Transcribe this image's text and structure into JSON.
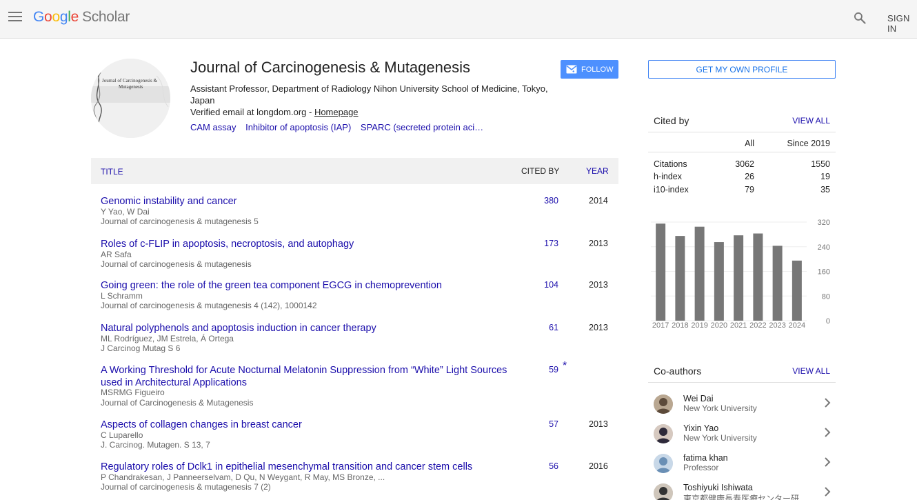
{
  "header": {
    "menu_icon": "hamburger-menu-icon",
    "logo_google": "Google",
    "logo_scholar": "Scholar",
    "search_icon": "search-icon",
    "sign_in": "SIGN IN",
    "logo_colors": [
      "#4285f4",
      "#ea4335",
      "#fbbc05",
      "#4285f4",
      "#34a853",
      "#ea4335"
    ]
  },
  "profile": {
    "name": "Journal of Carcinogenesis & Mutagenesis",
    "affiliation": "Assistant Professor, Department of Radiology Nihon University School of Medicine, Tokyo, Japan",
    "verified_email": "Verified email at longdom.org - ",
    "homepage": "Homepage",
    "interests": [
      "CAM assay",
      "Inhibitor of apoptosis (IAP)",
      "SPARC (secreted protein aci…"
    ],
    "follow_label": "FOLLOW",
    "avatar_text_1": "Journal of Carcinogenesis &",
    "avatar_text_2": "Mutagenesis"
  },
  "articles_table": {
    "col_title": "TITLE",
    "col_cited_by": "CITED BY",
    "col_year": "YEAR",
    "rows": [
      {
        "title": "Genomic instability and cancer",
        "authors": "Y Yao, W Dai",
        "venue": "Journal of carcinogenesis & mutagenesis 5",
        "cited_by": "380",
        "year": "2014",
        "star": ""
      },
      {
        "title": "Roles of c-FLIP in apoptosis, necroptosis, and autophagy",
        "authors": "AR Safa",
        "venue": "Journal of carcinogenesis & mutagenesis",
        "cited_by": "173",
        "year": "2013",
        "star": ""
      },
      {
        "title": "Going green: the role of the green tea component EGCG in chemoprevention",
        "authors": "L Schramm",
        "venue": "Journal of carcinogenesis & mutagenesis 4 (142), 1000142",
        "cited_by": "104",
        "year": "2013",
        "star": ""
      },
      {
        "title": "Natural polyphenols and apoptosis induction in cancer therapy",
        "authors": "ML Rodríguez, JM Estrela, Á Ortega",
        "venue": "J Carcinog Mutag S 6",
        "cited_by": "61",
        "year": "2013",
        "star": ""
      },
      {
        "title": "A Working Threshold for Acute Nocturnal Melatonin Suppression from “White” Light Sources used in Architectural Applications",
        "authors": "MSRMG Figueiro",
        "venue": "Journal of Carcinogenesis & Mutagenesis",
        "cited_by": "59",
        "year": "",
        "star": "*"
      },
      {
        "title": "Aspects of collagen changes in breast cancer",
        "authors": "C Luparello",
        "venue": "J. Carcinog. Mutagen. S 13, 7",
        "cited_by": "57",
        "year": "2013",
        "star": ""
      },
      {
        "title": "Regulatory roles of Dclk1 in epithelial mesenchymal transition and cancer stem cells",
        "authors": "P Chandrakesan, J Panneerselvam, D Qu, N Weygant, R May, MS Bronze, ...",
        "venue": "Journal of carcinogenesis & mutagenesis 7 (2)",
        "cited_by": "56",
        "year": "2016",
        "star": ""
      }
    ]
  },
  "sidebar": {
    "own_profile": "GET MY OWN PROFILE",
    "cited_by": {
      "title": "Cited by",
      "view_all": "VIEW ALL",
      "col_all": "All",
      "col_since": "Since 2019",
      "rows": [
        {
          "label": "Citations",
          "all": "3062",
          "since": "1550"
        },
        {
          "label": "h-index",
          "all": "26",
          "since": "19"
        },
        {
          "label": "i10-index",
          "all": "79",
          "since": "35"
        }
      ]
    },
    "coauthors": {
      "title": "Co-authors",
      "view_all": "VIEW ALL",
      "items": [
        {
          "name": "Wei Dai",
          "affiliation": "New York University"
        },
        {
          "name": "Yixin Yao",
          "affiliation": "New York University"
        },
        {
          "name": "fatima khan",
          "affiliation": "Professor"
        },
        {
          "name": "Toshiyuki Ishiwata",
          "affiliation": "東京都健康長寿医療センター研"
        }
      ]
    }
  },
  "chart_data": {
    "type": "bar",
    "categories": [
      "2017",
      "2018",
      "2019",
      "2020",
      "2021",
      "2022",
      "2023",
      "2024"
    ],
    "values": [
      315,
      275,
      305,
      255,
      277,
      283,
      243,
      195
    ],
    "yticks": [
      "320",
      "240",
      "160",
      "80",
      "0"
    ],
    "ylim": [
      0,
      320
    ],
    "bar_color": "#777777"
  }
}
